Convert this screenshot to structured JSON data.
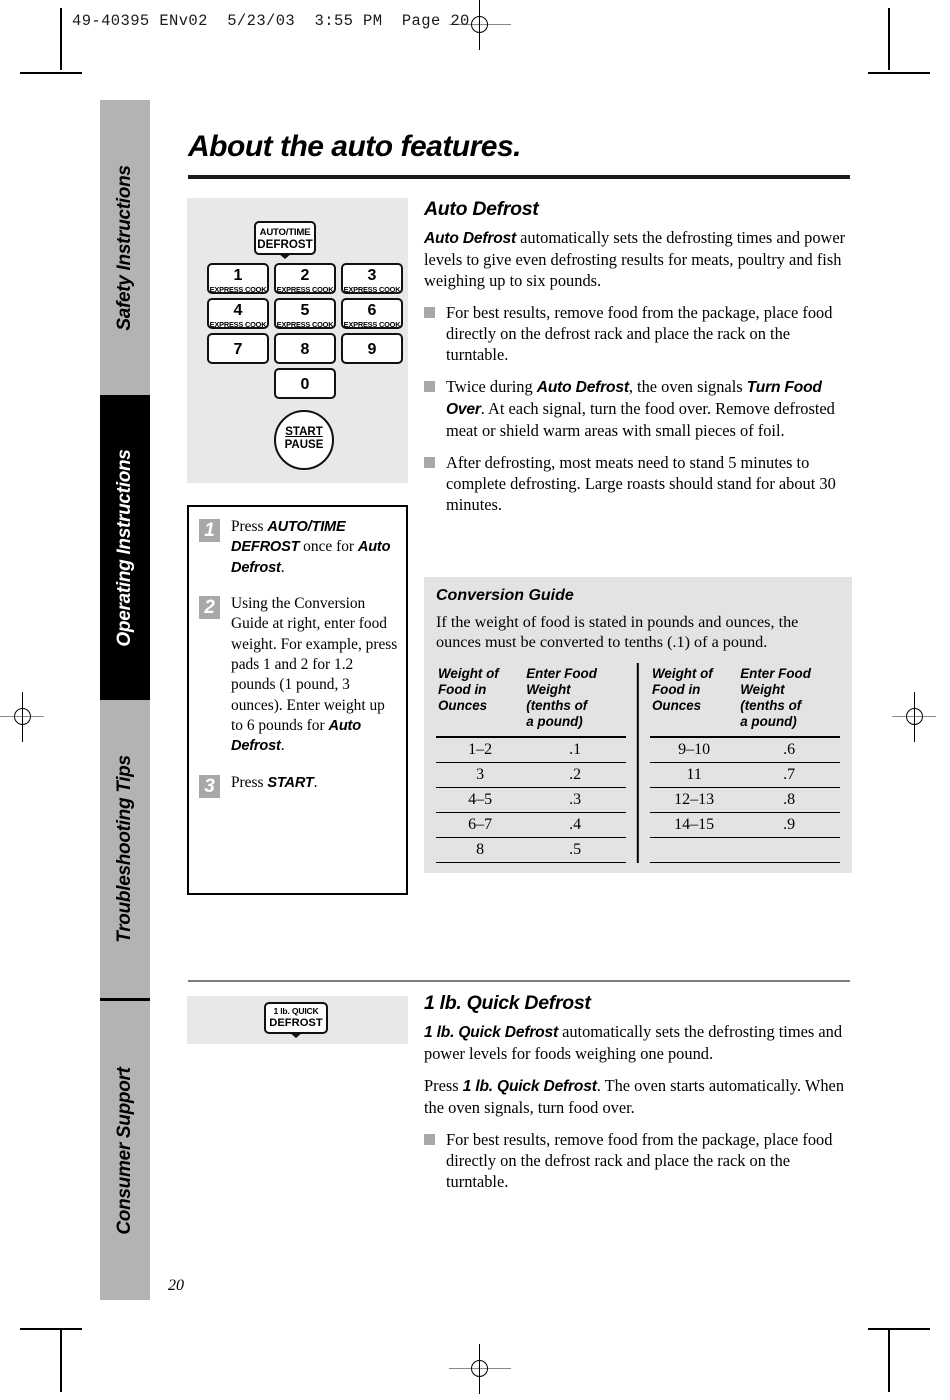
{
  "print_slug": "49-40395 ENv02  5/23/03  3:55 PM  Page 20",
  "page_number": "20",
  "page_title": "About the auto features.",
  "sidebar": {
    "tabs": [
      {
        "label": "Safety Instructions",
        "state": "inactive"
      },
      {
        "label": "Operating Instructions",
        "state": "active"
      },
      {
        "label": "Troubleshooting Tips",
        "state": "inactive"
      },
      {
        "label": "Consumer Support",
        "state": "inactive"
      }
    ]
  },
  "keypad": {
    "auto_defrost_button": {
      "line1": "AUTO/TIME",
      "line2": "DEFROST"
    },
    "pads": [
      {
        "num": "1",
        "sub": "EXPRESS COOK"
      },
      {
        "num": "2",
        "sub": "EXPRESS COOK"
      },
      {
        "num": "3",
        "sub": "EXPRESS COOK"
      },
      {
        "num": "4",
        "sub": "EXPRESS COOK"
      },
      {
        "num": "5",
        "sub": "EXPRESS COOK"
      },
      {
        "num": "6",
        "sub": "EXPRESS COOK"
      },
      {
        "num": "7",
        "sub": ""
      },
      {
        "num": "8",
        "sub": ""
      },
      {
        "num": "9",
        "sub": ""
      },
      {
        "num": "0",
        "sub": ""
      }
    ],
    "start_button": {
      "line1": "START",
      "line2": "PAUSE"
    }
  },
  "steps": [
    {
      "number": "1",
      "html": "Press <b>AUTO/TIME DEFROST</b> once for <b>Auto Defrost</b>."
    },
    {
      "number": "2",
      "html": "Using the Conversion Guide at right, enter food weight. For example, press pads 1 and 2 for 1.2 pounds (1 pound, 3 ounces). Enter weight up to 6 pounds for <b>Auto Defrost</b>."
    },
    {
      "number": "3",
      "html": "Press <b>START</b>."
    }
  ],
  "auto_defrost": {
    "heading": "Auto Defrost",
    "intro_html": "<b>Auto Defrost</b> automatically sets the defrosting times and power levels to give even defrosting results for meats, poultry and fish weighing up to six pounds.",
    "bullets": [
      "For best results, remove food from the package, place food directly on the defrost rack and place the rack on the turntable.",
      "Twice during <b>Auto Defrost</b>, the oven signals <b>Turn Food Over</b>. At each signal, turn the food over. Remove defrosted meat or shield warm areas with small pieces of foil.",
      "After defrosting, most meats need to stand 5 minutes to complete defrosting. Large roasts should stand for about 30 minutes."
    ]
  },
  "conversion_guide": {
    "title": "Conversion Guide",
    "description": "If the weight of food is stated in pounds and ounces, the ounces must be converted to tenths (.1) of a pound.",
    "columns": [
      "Weight of Food in Ounces",
      "Enter Food Weight (tenths of a pound)"
    ],
    "headers_left": [
      {
        "line1": "Weight of",
        "line2": "Food in",
        "line3": "Ounces"
      },
      {
        "line1": "Enter Food",
        "line2": "Weight",
        "line3": "(tenths of",
        "line4": "a pound)"
      }
    ],
    "headers_right": [
      {
        "line1": "Weight of",
        "line2": "Food in",
        "line3": "Ounces"
      },
      {
        "line1": "Enter Food",
        "line2": "Weight",
        "line3": "(tenths of",
        "line4": "a pound)"
      }
    ],
    "rows_left": [
      {
        "ounces": "1–2",
        "tenths": ".1"
      },
      {
        "ounces": "3",
        "tenths": ".2"
      },
      {
        "ounces": "4–5",
        "tenths": ".3"
      },
      {
        "ounces": "6–7",
        "tenths": ".4"
      },
      {
        "ounces": "8",
        "tenths": ".5"
      }
    ],
    "rows_right": [
      {
        "ounces": "9–10",
        "tenths": ".6"
      },
      {
        "ounces": "11",
        "tenths": ".7"
      },
      {
        "ounces": "12–13",
        "tenths": ".8"
      },
      {
        "ounces": "14–15",
        "tenths": ".9"
      }
    ]
  },
  "quick_defrost": {
    "button": {
      "line1": "1 lb. QUICK",
      "line2": "DEFROST"
    },
    "heading": "1 lb. Quick Defrost",
    "intro_html": "<b>1 lb. Quick Defrost</b> automatically sets the defrosting times and power levels for foods weighing one pound.",
    "paragraph_html": "Press <b>1 lb. Quick Defrost</b>. The oven starts automatically. When the oven signals, turn food over.",
    "bullets": [
      "For best results, remove food from the package, place food directly on the defrost rack and place the rack on the turntable."
    ]
  },
  "colors": {
    "tab_gray": "#b3b3b3",
    "tab_active": "#000000",
    "panel_gray": "#e8e8e8",
    "guide_gray": "#e3e3e3",
    "bullet_gray": "#a8a8a8"
  }
}
